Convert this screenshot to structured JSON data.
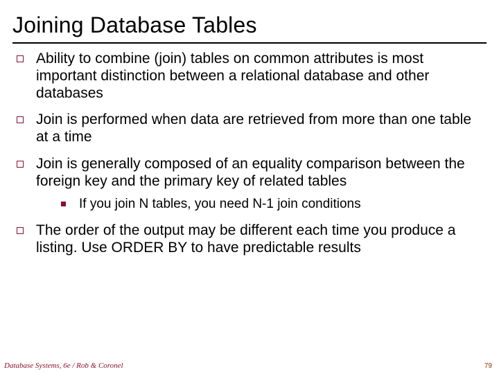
{
  "title": "Joining Database Tables",
  "bullets": [
    {
      "text": "Ability to combine (join) tables on common attributes is most important distinction between a relational database and other databases"
    },
    {
      "text": "Join is performed when data are retrieved from more than one table at a time"
    },
    {
      "text": "Join is generally composed of an equality comparison between the foreign key and the primary key of related tables",
      "sub": [
        {
          "text": "If you join N tables, you need N-1 join conditions"
        }
      ]
    },
    {
      "text": "The order of the output may be different each time you produce a listing. Use ORDER BY to have predictable results"
    }
  ],
  "footer_left": "Database Systems, 6e / Rob & Coronel",
  "footer_right": "79"
}
